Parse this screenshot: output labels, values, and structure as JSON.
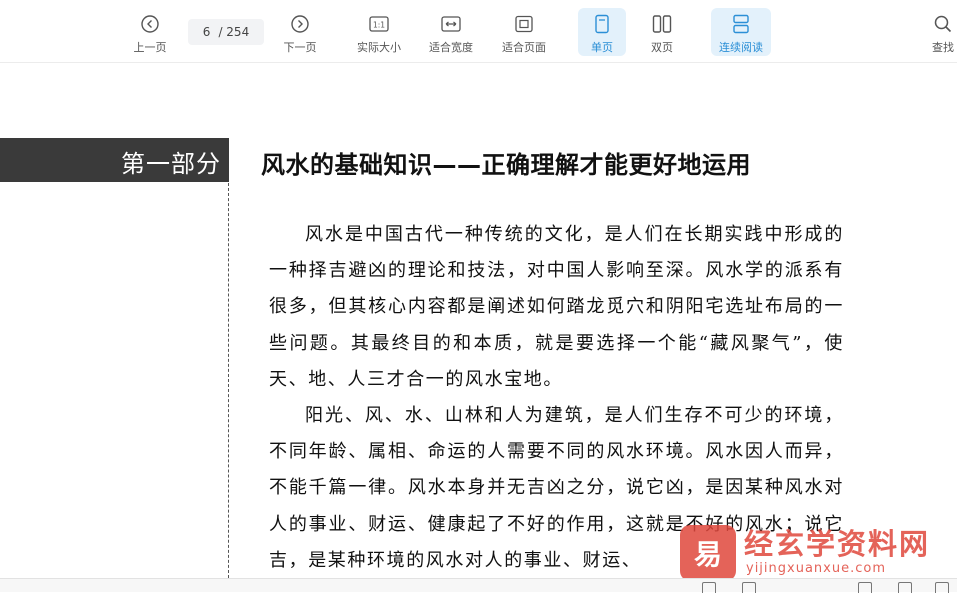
{
  "toolbar": {
    "prev_label": "上一页",
    "next_label": "下一页",
    "page_current": "6",
    "page_total": "/ 254",
    "actual_size_label": "实际大小",
    "fit_width_label": "适合宽度",
    "fit_page_label": "适合页面",
    "single_page_label": "单页",
    "double_page_label": "双页",
    "continuous_label": "连续阅读",
    "search_label": "查找",
    "actual_size_icon_text": "1:1",
    "accent_color": "#2b8fd6"
  },
  "page": {
    "part_label": "第一部分",
    "chapter_title": "风水的基础知识——正确理解才能更好地运用",
    "paragraphs": [
      "风水是中国古代一种传统的文化，是人们在长期实践中形成的一种择吉避凶的理论和技法，对中国人影响至深。风水学的派系有很多，但其核心内容都是阐述如何踏龙觅穴和阴阳宅选址布局的一些问题。其最终目的和本质，就是要选择一个能“藏风聚气”，使天、地、人三才合一的风水宝地。",
      "阳光、风、水、山林和人为建筑，是人们生存不可少的环境，不同年龄、属相、命运的人需要不同的风水环境。风水因人而异，不能千篇一律。风水本身并无吉凶之分，说它凶，是因某种风水对人的事业、财运、健康起了不好的作用，这就是不好的风水；说它吉，是某种环境的风水对人的事业、财运、"
    ]
  },
  "watermark": {
    "title": "经玄学资料网",
    "url": "yijingxuanxue.com",
    "logo_glyph": "易",
    "color": "#e0483d"
  }
}
